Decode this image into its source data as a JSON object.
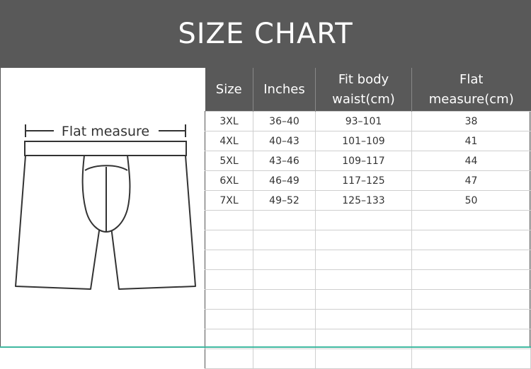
{
  "title": "SIZE CHART",
  "diagram": {
    "label": "Flat measure"
  },
  "table": {
    "headers": [
      "Size",
      "Inches",
      "Fit body waist(cm)",
      "Flat measure(cm)"
    ],
    "rows": [
      [
        "3XL",
        "36–40",
        "93–101",
        "38"
      ],
      [
        "4XL",
        "40–43",
        "101–109",
        "41"
      ],
      [
        "5XL",
        "43–46",
        "109–117",
        "44"
      ],
      [
        "6XL",
        "46–49",
        "117–125",
        "47"
      ],
      [
        "7XL",
        "49–52",
        "125–133",
        "50"
      ]
    ],
    "empty_rows": 8
  },
  "colors": {
    "header_bg": "#595959",
    "accent_line": "#3fb8a0"
  }
}
